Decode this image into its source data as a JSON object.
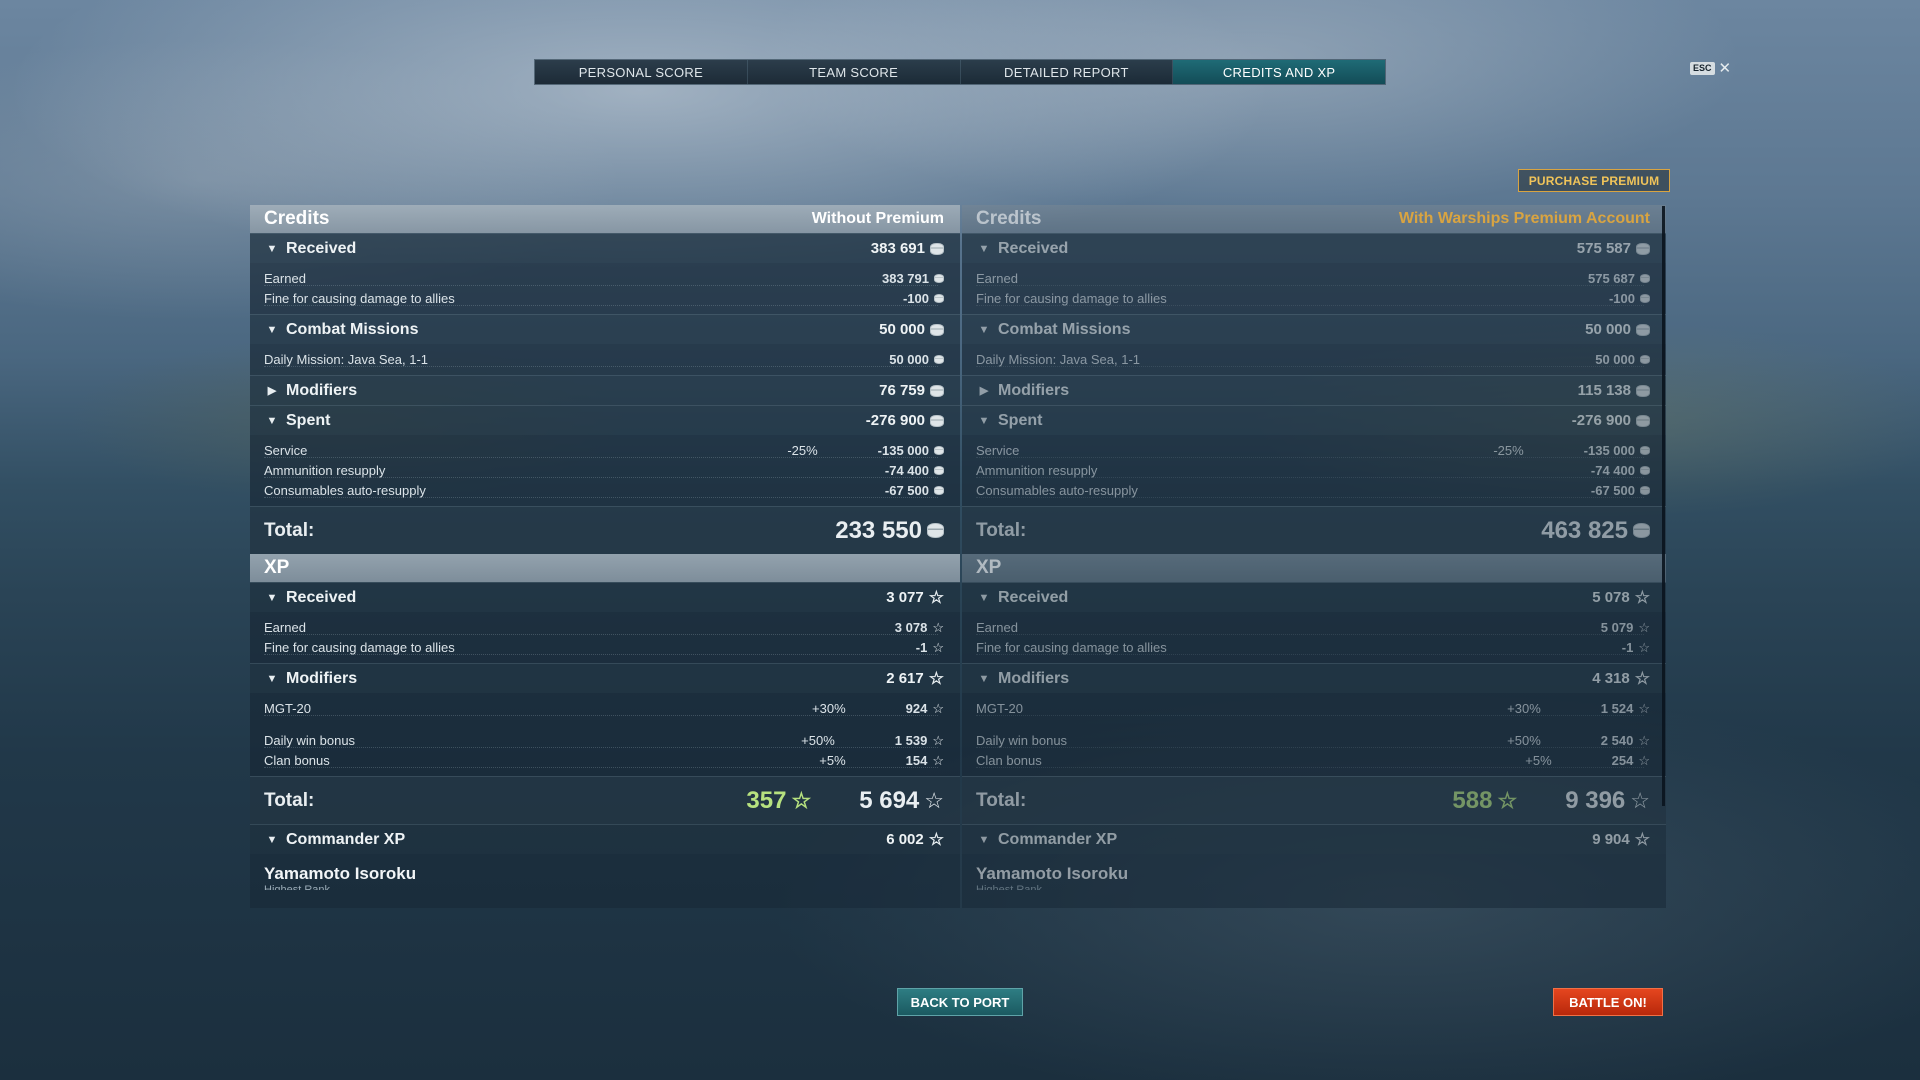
{
  "tabs": [
    "PERSONAL SCORE",
    "TEAM SCORE",
    "DETAILED REPORT",
    "CREDITS AND XP"
  ],
  "active_tab": "CREDITS AND XP",
  "esc": {
    "key": "ESC",
    "close": "✕"
  },
  "purchase_premium": "PURCHASE PREMIUM",
  "left": {
    "credits": {
      "title": "Credits",
      "subtitle": "Without Premium",
      "received": {
        "label": "Received",
        "value": "383 691",
        "rows": [
          {
            "label": "Earned",
            "value": "383 791"
          },
          {
            "label": "Fine for causing damage to allies",
            "value": "-100"
          }
        ]
      },
      "missions": {
        "label": "Combat Missions",
        "value": "50 000",
        "rows": [
          {
            "label": "Daily Mission: Java Sea, 1-1",
            "value": "50 000"
          }
        ]
      },
      "modifiers": {
        "label": "Modifiers",
        "value": "76 759"
      },
      "spent": {
        "label": "Spent",
        "value": "-276 900",
        "rows": [
          {
            "label": "Service",
            "pct": "-25%",
            "value": "-135 000"
          },
          {
            "label": "Ammunition resupply",
            "value": "-74 400"
          },
          {
            "label": "Consumables auto-resupply",
            "value": "-67 500"
          }
        ]
      },
      "total": {
        "label": "Total:",
        "value": "233 550"
      }
    },
    "xp": {
      "title": "XP",
      "received": {
        "label": "Received",
        "value": "3 077",
        "rows": [
          {
            "label": "Earned",
            "value": "3 078"
          },
          {
            "label": "Fine for causing damage to allies",
            "value": "-1"
          }
        ]
      },
      "modifiers": {
        "label": "Modifiers",
        "value": "2 617",
        "rows": [
          {
            "label": "MGT-20",
            "pct": "+30%",
            "value": "924"
          },
          {
            "label": "Daily win bonus",
            "pct": "+50%",
            "value": "1 539"
          },
          {
            "label": "Clan bonus",
            "pct": "+5%",
            "value": "154"
          }
        ]
      },
      "total": {
        "label": "Total:",
        "free": "357",
        "value": "5 694"
      },
      "commander": {
        "label": "Commander XP",
        "value": "6 002"
      },
      "commander_name": "Yamamoto Isoroku",
      "commander_rank": "Highest Rank"
    }
  },
  "right": {
    "credits": {
      "title": "Credits",
      "subtitle": "With Warships Premium Account",
      "received": {
        "label": "Received",
        "value": "575 587",
        "rows": [
          {
            "label": "Earned",
            "value": "575 687"
          },
          {
            "label": "Fine for causing damage to allies",
            "value": "-100"
          }
        ]
      },
      "missions": {
        "label": "Combat Missions",
        "value": "50 000",
        "rows": [
          {
            "label": "Daily Mission: Java Sea, 1-1",
            "value": "50 000"
          }
        ]
      },
      "modifiers": {
        "label": "Modifiers",
        "value": "115 138"
      },
      "spent": {
        "label": "Spent",
        "value": "-276 900",
        "rows": [
          {
            "label": "Service",
            "pct": "-25%",
            "value": "-135 000"
          },
          {
            "label": "Ammunition resupply",
            "value": "-74 400"
          },
          {
            "label": "Consumables auto-resupply",
            "value": "-67 500"
          }
        ]
      },
      "total": {
        "label": "Total:",
        "value": "463 825"
      }
    },
    "xp": {
      "title": "XP",
      "received": {
        "label": "Received",
        "value": "5 078",
        "rows": [
          {
            "label": "Earned",
            "value": "5 079"
          },
          {
            "label": "Fine for causing damage to allies",
            "value": "-1"
          }
        ]
      },
      "modifiers": {
        "label": "Modifiers",
        "value": "4 318",
        "rows": [
          {
            "label": "MGT-20",
            "pct": "+30%",
            "value": "1 524"
          },
          {
            "label": "Daily win bonus",
            "pct": "+50%",
            "value": "2 540"
          },
          {
            "label": "Clan bonus",
            "pct": "+5%",
            "value": "254"
          }
        ]
      },
      "total": {
        "label": "Total:",
        "free": "588",
        "value": "9 396"
      },
      "commander": {
        "label": "Commander XP",
        "value": "9 904"
      },
      "commander_name": "Yamamoto Isoroku",
      "commander_rank": "Highest Rank"
    }
  },
  "buttons": {
    "back": "BACK TO PORT",
    "battle": "BATTLE ON!"
  },
  "colors": {
    "accent_teal": "#1f6b76",
    "premium_gold": "#d9a441",
    "battle_red": "#e5461f",
    "free_xp_green": "#b7e27f"
  },
  "icons": {
    "credit": "credit-coin-icon",
    "xp": "xp-star-icon",
    "expand": "triangle-down-icon",
    "collapsed": "triangle-right-icon"
  }
}
